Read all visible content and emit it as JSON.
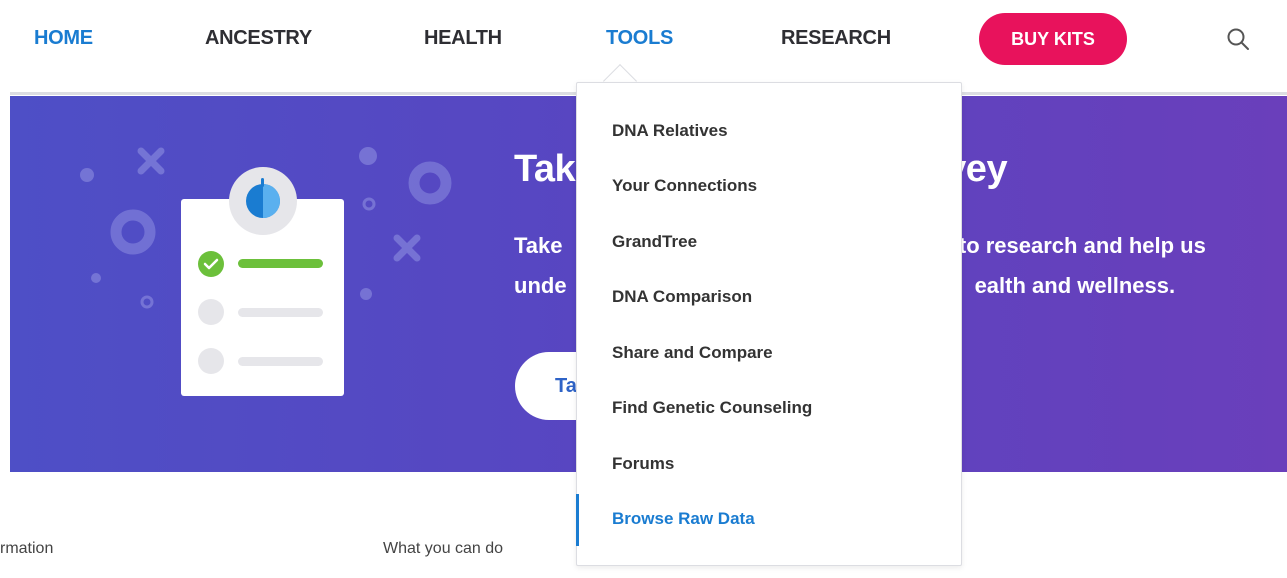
{
  "nav": {
    "items": [
      {
        "label": "HOME",
        "active": false
      },
      {
        "label": "ANCESTRY",
        "active": false
      },
      {
        "label": "HEALTH",
        "active": false
      },
      {
        "label": "TOOLS",
        "active": true
      },
      {
        "label": "RESEARCH",
        "active": false
      }
    ],
    "buy_kits_label": "BUY KITS",
    "search_icon": "search-icon"
  },
  "banner": {
    "title_visible_left": "Tak",
    "title_visible_right": "vey",
    "text_line1_left": "Take",
    "text_line1_right": "e to research and help us",
    "text_line2_left": "unde",
    "text_line2_right": "ealth and wellness.",
    "cta_visible": "Ta",
    "illustration_icon": "survey-clipboard-icon"
  },
  "section": {
    "col_info": "rmation",
    "col_can_do": "What you can do"
  },
  "dropdown": {
    "items": [
      {
        "label": "DNA Relatives",
        "active": false
      },
      {
        "label": "Your Connections",
        "active": false
      },
      {
        "label": "GrandTree",
        "active": false
      },
      {
        "label": "DNA Comparison",
        "active": false
      },
      {
        "label": "Share and Compare",
        "active": false
      },
      {
        "label": "Find Genetic Counseling",
        "active": false
      },
      {
        "label": "Forums",
        "active": false
      },
      {
        "label": "Browse Raw Data",
        "active": true
      }
    ]
  },
  "colors": {
    "accent_blue": "#1a7cd1",
    "buy_kits_pink": "#e8125c",
    "banner_start": "#4e4fc6",
    "banner_end": "#6a3fbb",
    "check_green": "#6cc03b"
  }
}
